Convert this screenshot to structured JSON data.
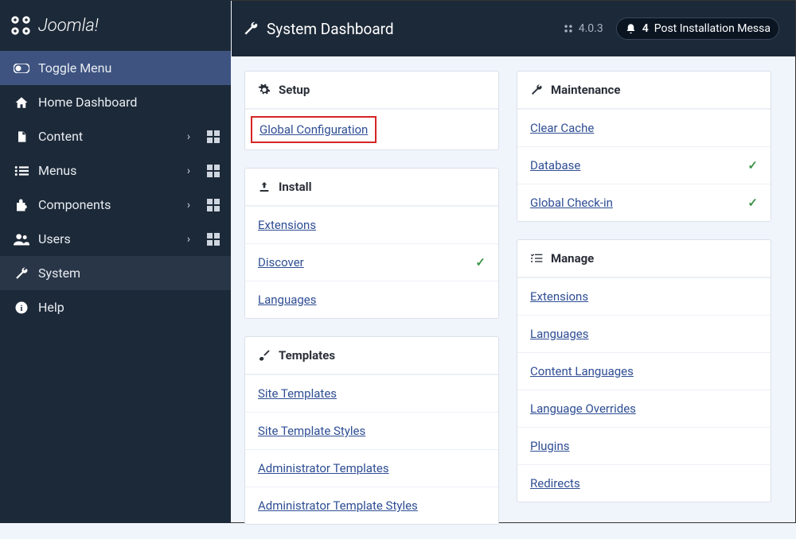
{
  "brand": "Joomla!",
  "topbar": {
    "title": "System Dashboard",
    "version": "4.0.3",
    "notif_count": "4",
    "notif_text": "Post Installation Messa"
  },
  "sidebar": {
    "toggle": "Toggle Menu",
    "items": [
      {
        "label": "Home Dashboard"
      },
      {
        "label": "Content"
      },
      {
        "label": "Menus"
      },
      {
        "label": "Components"
      },
      {
        "label": "Users"
      },
      {
        "label": "System"
      },
      {
        "label": "Help"
      }
    ]
  },
  "cards": {
    "setup": {
      "title": "Setup",
      "links": [
        "Global Configuration"
      ]
    },
    "install": {
      "title": "Install",
      "links": [
        "Extensions",
        "Discover",
        "Languages"
      ],
      "check_index": 1
    },
    "templates": {
      "title": "Templates",
      "links": [
        "Site Templates",
        "Site Template Styles",
        "Administrator Templates",
        "Administrator Template Styles"
      ]
    },
    "maintenance": {
      "title": "Maintenance",
      "links": [
        "Clear Cache",
        "Database",
        "Global Check-in"
      ],
      "check_indexes": [
        1,
        2
      ]
    },
    "manage": {
      "title": "Manage",
      "links": [
        "Extensions",
        "Languages",
        "Content Languages",
        "Language Overrides",
        "Plugins",
        "Redirects"
      ]
    }
  }
}
